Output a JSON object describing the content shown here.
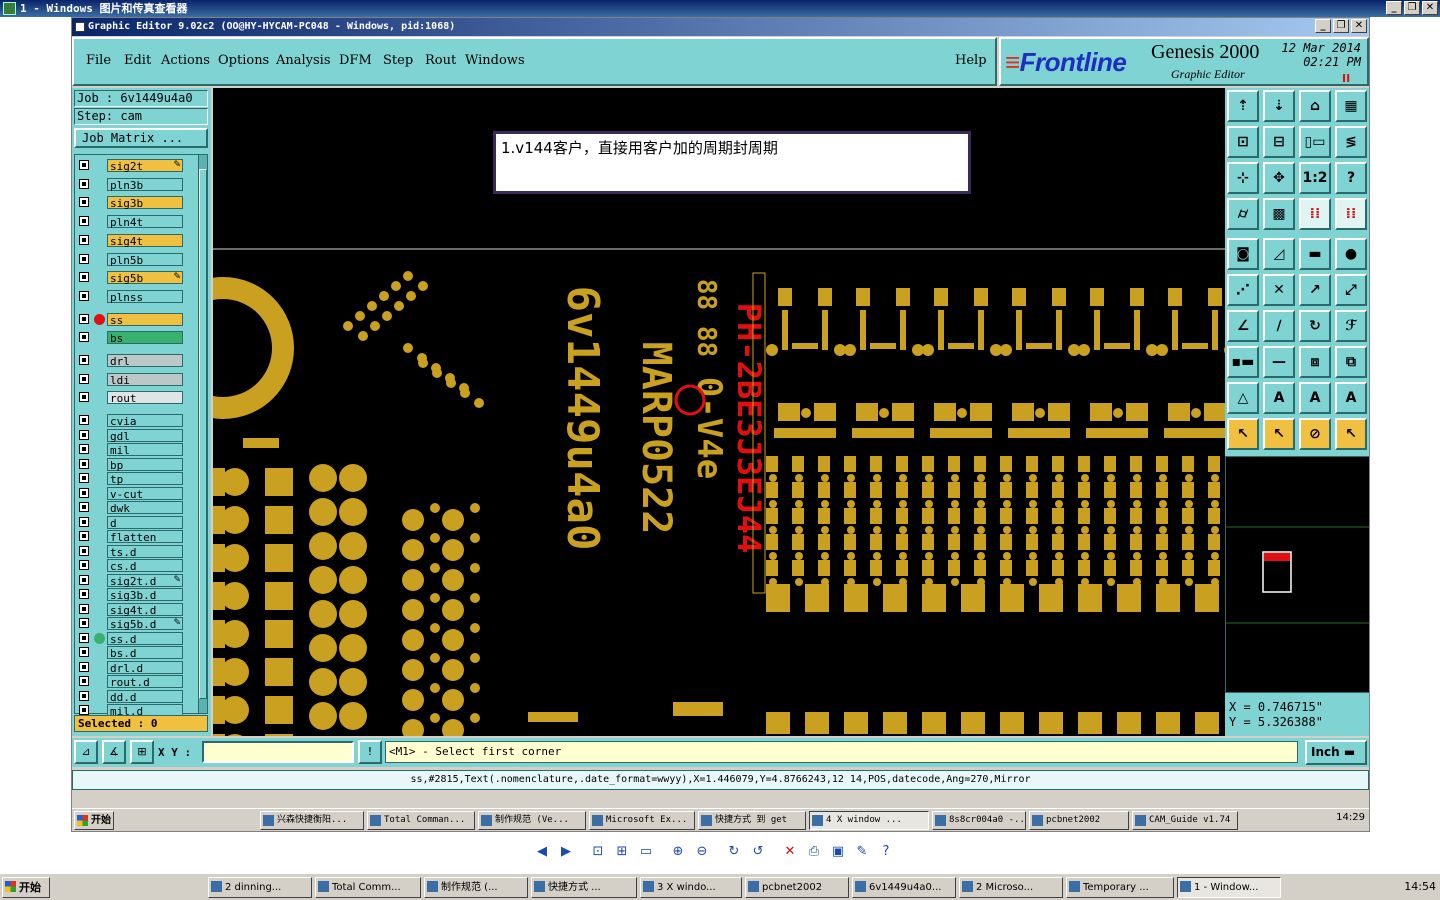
{
  "viewer": {
    "title": "1 - Windows 图片和传真查看器"
  },
  "ge": {
    "title": "Graphic Editor 9.02c2 (OO@HY-HYCAM-PC048 - Windows, pid:1068)",
    "menus": [
      "File",
      "Edit",
      "Actions",
      "Options",
      "Analysis",
      "DFM",
      "Step",
      "Rout",
      "Windows"
    ],
    "help": "Help",
    "brand": {
      "logo": "Frontline",
      "product": "Genesis 2000",
      "subtitle": "Graphic Editor",
      "date": "12 Mar 2014",
      "time": "02:21 PM",
      "pause": "II"
    }
  },
  "left": {
    "job_label": "Job : 6v1449u4a0",
    "step_label": "Step: cam",
    "job_matrix": "Job Matrix ...",
    "selected": "Selected : 0",
    "layers": [
      {
        "name": "sig2t",
        "bg": "yellow",
        "edit": true
      },
      {
        "name": "pln3b",
        "bg": "cyan"
      },
      {
        "name": "sig3b",
        "bg": "yellow"
      },
      {
        "name": "pln4t",
        "bg": "cyan"
      },
      {
        "name": "sig4t",
        "bg": "yellow"
      },
      {
        "name": "pln5b",
        "bg": "cyan"
      },
      {
        "name": "sig5b",
        "bg": "yellow",
        "edit": true
      },
      {
        "name": "plnss",
        "bg": "cyan"
      },
      {
        "name": "ss",
        "bg": "yellow",
        "dot": "#e01010",
        "active": true
      },
      {
        "name": "bs",
        "bg": "green"
      },
      {
        "name": "drl",
        "bg": "grey"
      },
      {
        "name": "ldi",
        "bg": "grey"
      },
      {
        "name": "rout",
        "bg": "silver"
      },
      {
        "name": "cvia",
        "bg": "cyan"
      },
      {
        "name": "gdl",
        "bg": "cyan"
      },
      {
        "name": "mil",
        "bg": "cyan"
      },
      {
        "name": "bp",
        "bg": "cyan"
      },
      {
        "name": "tp",
        "bg": "cyan"
      },
      {
        "name": "v-cut",
        "bg": "cyan"
      },
      {
        "name": "dwk",
        "bg": "cyan"
      },
      {
        "name": "d",
        "bg": "cyan"
      },
      {
        "name": "flatten",
        "bg": "cyan"
      },
      {
        "name": "ts.d",
        "bg": "cyan"
      },
      {
        "name": "cs.d",
        "bg": "cyan"
      },
      {
        "name": "sig2t.d",
        "bg": "cyan",
        "edit": true
      },
      {
        "name": "sig3b.d",
        "bg": "cyan"
      },
      {
        "name": "sig4t.d",
        "bg": "cyan"
      },
      {
        "name": "sig5b.d",
        "bg": "cyan",
        "edit": true
      },
      {
        "name": "ss.d",
        "bg": "cyan",
        "dot": "#38b070"
      },
      {
        "name": "bs.d",
        "bg": "cyan"
      },
      {
        "name": "drl.d",
        "bg": "cyan"
      },
      {
        "name": "rout.d",
        "bg": "cyan"
      },
      {
        "name": "dd.d",
        "bg": "cyan"
      },
      {
        "name": "mil.d",
        "bg": "cyan"
      }
    ]
  },
  "canvas": {
    "note": "1.v144客户，直接用客户加的周期封周期",
    "rotated_texts": [
      "6v1449u4a0",
      "MARP0522",
      "0-V4e",
      "88 88",
      "PH-2BE3J3EJ44"
    ]
  },
  "right": {
    "tools": [
      {
        "icon": "open-icon",
        "glyph": "⇡"
      },
      {
        "icon": "save-icon",
        "glyph": "⇣"
      },
      {
        "icon": "home-icon",
        "glyph": "⌂"
      },
      {
        "icon": "window-icon",
        "glyph": "▦"
      },
      {
        "icon": "zoom-in-icon",
        "glyph": "⊡"
      },
      {
        "icon": "zoom-out-icon",
        "glyph": "⊟"
      },
      {
        "icon": "ratio-icon",
        "glyph": "▯▭"
      },
      {
        "icon": "snap-icon",
        "glyph": "≶"
      },
      {
        "icon": "fit-icon",
        "glyph": "⊹"
      },
      {
        "icon": "pan-icon",
        "glyph": "✥"
      },
      {
        "icon": "scale-icon",
        "glyph": "1:2"
      },
      {
        "icon": "help-icon",
        "glyph": "?"
      },
      {
        "icon": "measure-icon",
        "glyph": "⌭"
      },
      {
        "icon": "grid-icon",
        "glyph": "▩"
      },
      {
        "icon": "net-icon",
        "glyph": "⁞⁞",
        "sel": true
      },
      {
        "icon": "net2-icon",
        "glyph": "⁞⁞",
        "sel": true
      },
      {
        "icon": "pad-icon",
        "glyph": "◙"
      },
      {
        "icon": "line-icon",
        "glyph": "◿"
      },
      {
        "icon": "ruler-icon",
        "glyph": "▬"
      },
      {
        "icon": "dot-icon",
        "glyph": "●"
      },
      {
        "icon": "connect-icon",
        "glyph": "⋰"
      },
      {
        "icon": "cross-icon",
        "glyph": "✕"
      },
      {
        "icon": "join-icon",
        "glyph": "↗"
      },
      {
        "icon": "vertex-icon",
        "glyph": "⤢"
      },
      {
        "icon": "angle-icon",
        "glyph": "∠"
      },
      {
        "icon": "slash-icon",
        "glyph": "∕"
      },
      {
        "icon": "arc-icon",
        "glyph": "↻"
      },
      {
        "icon": "ff-icon",
        "glyph": "ℱ"
      },
      {
        "icon": "dash-icon",
        "glyph": "▪▬"
      },
      {
        "icon": "minus-icon",
        "glyph": "—"
      },
      {
        "icon": "box-icon",
        "glyph": "⧈"
      },
      {
        "icon": "group-icon",
        "glyph": "⧉"
      },
      {
        "icon": "tri1-icon",
        "glyph": "△"
      },
      {
        "icon": "tri2-icon",
        "glyph": "A"
      },
      {
        "icon": "tri3-icon",
        "glyph": "A"
      },
      {
        "icon": "tri4-icon",
        "glyph": "A"
      },
      {
        "icon": "pointer-icon",
        "glyph": "↖",
        "yellow": true
      },
      {
        "icon": "pointer2-icon",
        "glyph": "↖",
        "yellow": true
      },
      {
        "icon": "pointer3-icon",
        "glyph": "⊘",
        "yellow": true
      },
      {
        "icon": "pointer4-icon",
        "glyph": "↖",
        "yellow": true
      }
    ],
    "coord_x": "X = 0.746715\"",
    "coord_y": "Y = 5.326388\""
  },
  "cmd": {
    "xy_label": "X Y :",
    "xy_value": "",
    "prompt": "<M1> - Select first corner",
    "units": "Inch"
  },
  "status": "ss,#2815,Text(.nomenclature,.date_format=wwyy),X=1.446079,Y=4.8766243,12 14,POS,datecode,Ang=270,Mirror",
  "inner_taskbar": {
    "start": "开始",
    "items": [
      "兴森快捷衡阳...",
      "Total Comman...",
      "制作规范 (Ve...",
      "Microsoft Ex...",
      "快捷方式 到 get",
      "4 X window ...",
      "8s8cr004a0 -...",
      "pcbnet2002",
      "CAM_Guide v1.74"
    ],
    "clock": "14:29"
  },
  "outer_taskbar": {
    "start": "开始",
    "items": [
      "2 dinning...",
      "Total Comm...",
      "制作规范 (...",
      "快捷方式 ...",
      "3 X windo...",
      "pcbnet2002",
      "6v1449u4a0...",
      "2 Microso...",
      "Temporary ...",
      "1 - Window..."
    ],
    "clock": "14:54"
  },
  "viewer_toolbar": [
    "prev-icon",
    "next-icon",
    "best-fit-icon",
    "actual-size-icon",
    "slideshow-icon",
    "zoom-in-icon",
    "zoom-out-icon",
    "rotate-cw-icon",
    "rotate-ccw-icon",
    "delete-icon",
    "print-icon",
    "save-icon",
    "edit-icon",
    "help-icon"
  ]
}
